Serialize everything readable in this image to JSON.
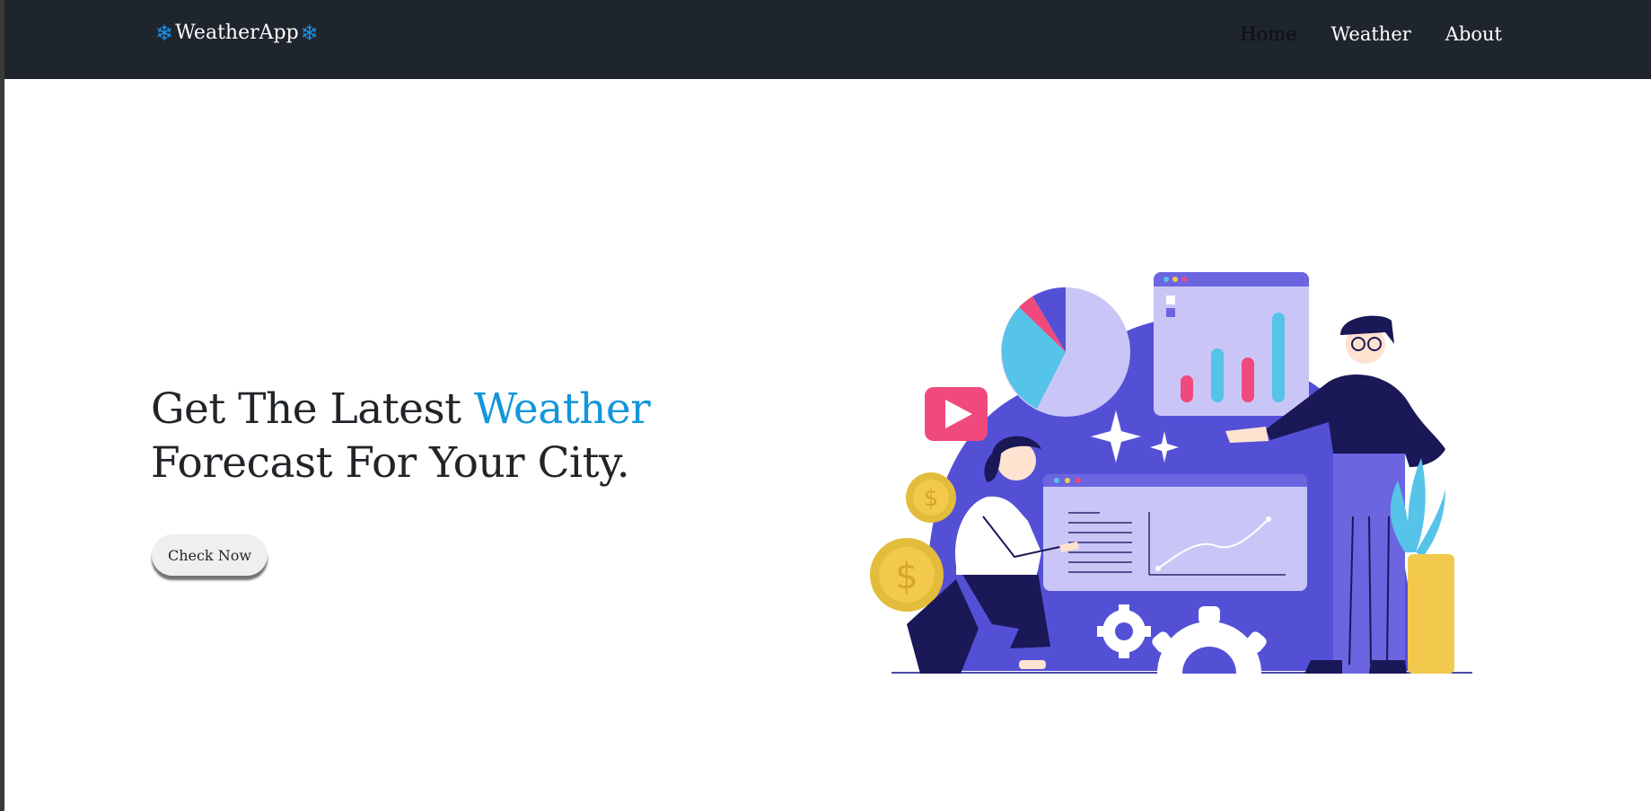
{
  "nav": {
    "brand_icon_left": "❄",
    "brand": "WeatherApp",
    "brand_icon_right": "❄",
    "links": [
      "Home",
      "Weather",
      "About"
    ],
    "active": "Home"
  },
  "hero": {
    "title_part1": "Get The Latest ",
    "title_accent": "Weather",
    "title_part2": " Forecast For Your City.",
    "button_label": "Check Now"
  },
  "colors": {
    "navbar_bg": "#1f252d",
    "accent": "#1296db",
    "illustration_primary": "#5450d6",
    "illustration_light": "#c9c6f7"
  },
  "icons": {
    "brand": "snowflake-icon",
    "illustration": "analytics-illustration"
  }
}
